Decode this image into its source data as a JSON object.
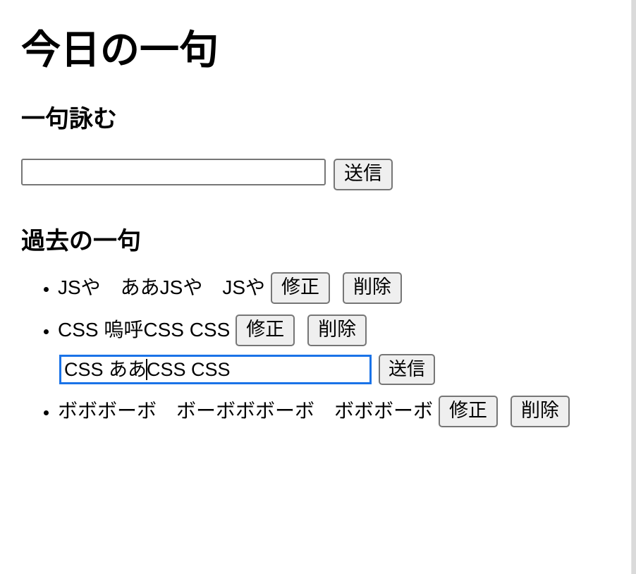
{
  "page": {
    "title": "今日の一句",
    "compose_heading": "一句詠む",
    "past_heading": "過去の一句"
  },
  "compose_form": {
    "input_value": "",
    "input_placeholder": "",
    "submit_label": "送信"
  },
  "buttons": {
    "edit_label": "修正",
    "delete_label": "削除",
    "submit_label": "送信"
  },
  "haiku_list": [
    {
      "text": "JSや　ああJSや　JSや",
      "edit_label": "修正",
      "delete_label": "削除",
      "editing": false
    },
    {
      "text": "CSS 嗚呼CSS CSS",
      "edit_label": "修正",
      "delete_label": "削除",
      "editing": true,
      "edit_value_before_caret": "CSS ああ",
      "edit_value_after_caret": "CSS CSS",
      "edit_submit_label": "送信"
    },
    {
      "text": "ボボボーボ　ボーボボボーボ　ボボボーボ",
      "edit_label": "修正",
      "delete_label": "削除",
      "editing": false
    }
  ],
  "colors": {
    "background": "#ffffff",
    "text": "#000000",
    "button_face": "#efefef",
    "control_border": "#767676",
    "focus_border": "#1a73e8",
    "scrollbar_thumb": "#dadada"
  },
  "scrollbar": {
    "orientation": "vertical",
    "position": "right"
  }
}
